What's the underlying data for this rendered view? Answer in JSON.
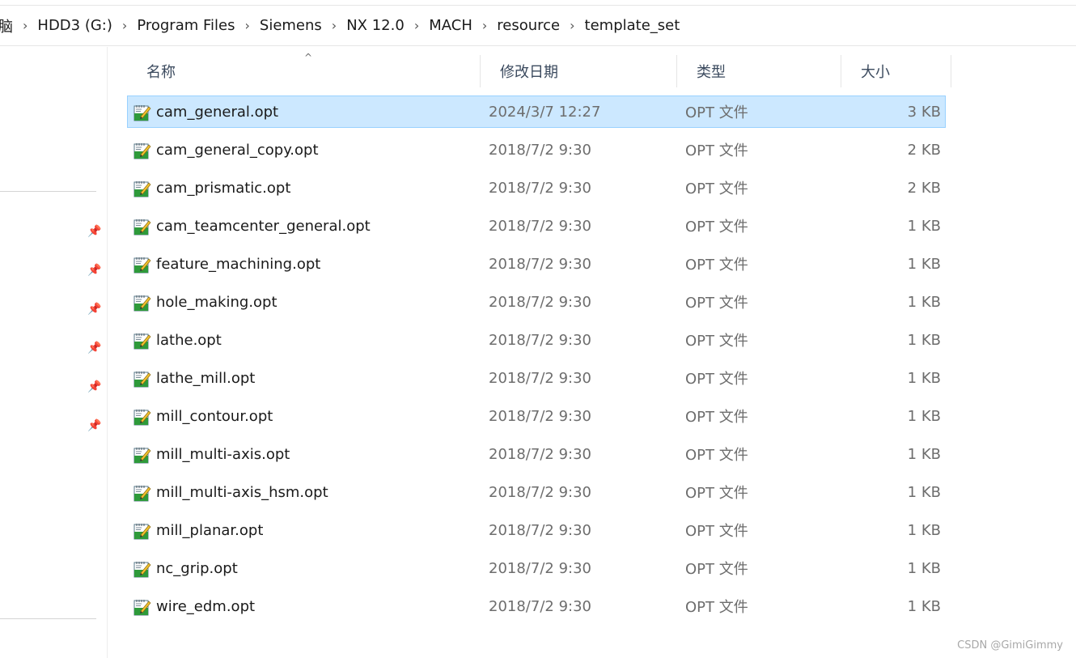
{
  "breadcrumb": [
    "脑",
    "HDD3 (G:)",
    "Program Files",
    "Siemens",
    "NX 12.0",
    "MACH",
    "resource",
    "template_set"
  ],
  "columns": {
    "name": "名称",
    "date": "修改日期",
    "type": "类型",
    "size": "大小"
  },
  "sort_indicator": "^",
  "files": [
    {
      "name": "cam_general.opt",
      "date": "2024/3/7 12:27",
      "type": "OPT 文件",
      "size": "3 KB",
      "selected": true
    },
    {
      "name": "cam_general_copy.opt",
      "date": "2018/7/2 9:30",
      "type": "OPT 文件",
      "size": "2 KB"
    },
    {
      "name": "cam_prismatic.opt",
      "date": "2018/7/2 9:30",
      "type": "OPT 文件",
      "size": "2 KB"
    },
    {
      "name": "cam_teamcenter_general.opt",
      "date": "2018/7/2 9:30",
      "type": "OPT 文件",
      "size": "1 KB"
    },
    {
      "name": "feature_machining.opt",
      "date": "2018/7/2 9:30",
      "type": "OPT 文件",
      "size": "1 KB"
    },
    {
      "name": "hole_making.opt",
      "date": "2018/7/2 9:30",
      "type": "OPT 文件",
      "size": "1 KB"
    },
    {
      "name": "lathe.opt",
      "date": "2018/7/2 9:30",
      "type": "OPT 文件",
      "size": "1 KB"
    },
    {
      "name": "lathe_mill.opt",
      "date": "2018/7/2 9:30",
      "type": "OPT 文件",
      "size": "1 KB"
    },
    {
      "name": "mill_contour.opt",
      "date": "2018/7/2 9:30",
      "type": "OPT 文件",
      "size": "1 KB"
    },
    {
      "name": "mill_multi-axis.opt",
      "date": "2018/7/2 9:30",
      "type": "OPT 文件",
      "size": "1 KB"
    },
    {
      "name": "mill_multi-axis_hsm.opt",
      "date": "2018/7/2 9:30",
      "type": "OPT 文件",
      "size": "1 KB"
    },
    {
      "name": "mill_planar.opt",
      "date": "2018/7/2 9:30",
      "type": "OPT 文件",
      "size": "1 KB"
    },
    {
      "name": "nc_grip.opt",
      "date": "2018/7/2 9:30",
      "type": "OPT 文件",
      "size": "1 KB"
    },
    {
      "name": "wire_edm.opt",
      "date": "2018/7/2 9:30",
      "type": "OPT 文件",
      "size": "1 KB"
    }
  ],
  "pins": [
    "pin-icon",
    "pin-icon",
    "pin-icon",
    "pin-icon",
    "pin-icon",
    "pin-icon"
  ],
  "icons": {
    "file": "notepad-file-icon",
    "separator": "chevron-right-icon",
    "pin": "pin-icon"
  },
  "colors": {
    "selection_bg": "#cce8ff",
    "selection_border": "#99d1ff",
    "header_text": "#3b4a5e",
    "meta_text": "#6d6d6d"
  },
  "watermark": "CSDN @GimiGimmy"
}
